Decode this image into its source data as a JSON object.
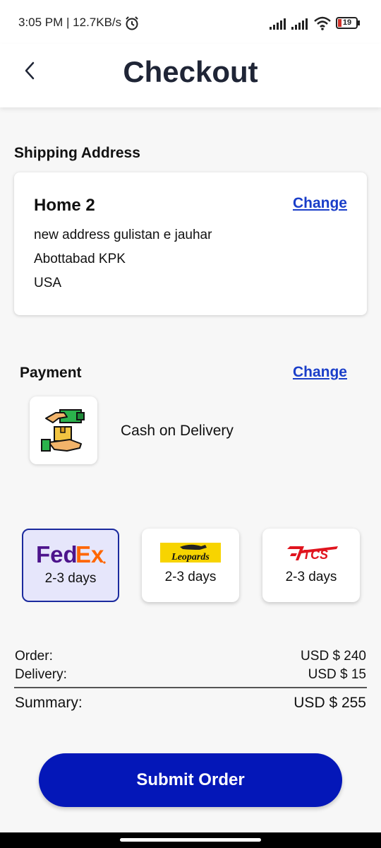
{
  "status_bar": {
    "text": "3:05 PM | 12.7KB/s",
    "battery_level": "19",
    "icons": [
      "alarm-icon",
      "signal-icon",
      "signal-icon",
      "wifi-icon",
      "battery-icon"
    ]
  },
  "header": {
    "back_icon": "chevron-left-icon",
    "title": "Checkout"
  },
  "shipping": {
    "section_title": "Shipping Address",
    "name": "Home 2",
    "change_label": "Change",
    "lines": [
      "new address gulistan e jauhar",
      "Abottabad KPK",
      "USA"
    ]
  },
  "payment": {
    "section_title": "Payment",
    "change_label": "Change",
    "icon": "cash-on-delivery-icon",
    "method": "Cash on Delivery"
  },
  "couriers": [
    {
      "name": "FedEx",
      "logo_text": "FedEx",
      "days": "2-3 days",
      "selected": true
    },
    {
      "name": "Leopards",
      "logo_text": "Leopards",
      "days": "2-3 days",
      "selected": false
    },
    {
      "name": "TCS",
      "logo_text": "TCS",
      "days": "2-3 days",
      "selected": false
    }
  ],
  "summary": {
    "order_label": "Order:",
    "order_value": "USD $ 240",
    "delivery_label": "Delivery:",
    "delivery_value": "USD $ 15",
    "total_label": "Summary:",
    "total_value": "USD $ 255"
  },
  "submit_label": "Submit Order",
  "colors": {
    "primary": "#0417b8",
    "link": "#1a3ec9",
    "selected_bg": "#e6e6fb",
    "title": "#1f2536"
  }
}
